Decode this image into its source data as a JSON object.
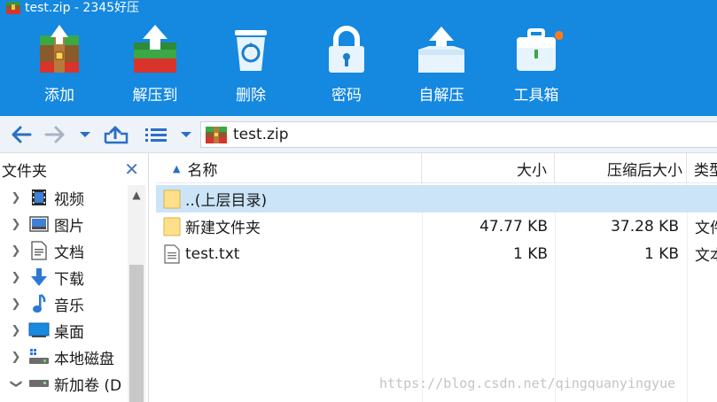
{
  "window": {
    "title": "test.zip - 2345好压"
  },
  "toolbar": {
    "tools": [
      {
        "label": "添加",
        "icon": "add-archive-icon"
      },
      {
        "label": "解压到",
        "icon": "extract-to-icon"
      },
      {
        "label": "删除",
        "icon": "recycle-bin-icon"
      },
      {
        "label": "密码",
        "icon": "lock-icon"
      },
      {
        "label": "自解压",
        "icon": "self-extract-icon"
      },
      {
        "label": "工具箱",
        "icon": "toolbox-icon"
      }
    ]
  },
  "nav": {
    "back_icon": "back-arrow-icon",
    "forward_icon": "forward-arrow-icon",
    "dropdown_icon": "chevron-down-icon",
    "up_icon": "up-folder-icon",
    "view_icon": "list-view-icon",
    "path": "test.zip"
  },
  "sidebar": {
    "title": "文件夹",
    "close_icon": "close-icon",
    "items": [
      {
        "label": "视频",
        "icon": "video-icon"
      },
      {
        "label": "图片",
        "icon": "picture-icon"
      },
      {
        "label": "文档",
        "icon": "document-icon"
      },
      {
        "label": "下载",
        "icon": "download-icon"
      },
      {
        "label": "音乐",
        "icon": "music-icon"
      },
      {
        "label": "桌面",
        "icon": "desktop-icon"
      },
      {
        "label": "本地磁盘",
        "icon": "local-disk-icon"
      },
      {
        "label": "新加卷 (D",
        "icon": "drive-icon"
      }
    ]
  },
  "filelist": {
    "columns": {
      "name": "名称",
      "size": "大小",
      "packed": "压缩后大小",
      "type": "类型"
    },
    "rows": [
      {
        "name": "..(上层目录)",
        "size": "",
        "packed": "",
        "type": "",
        "icon": "folder-icon",
        "selected": true
      },
      {
        "name": "新建文件夹",
        "size": "47.77 KB",
        "packed": "37.28 KB",
        "type": "文件",
        "icon": "folder-icon",
        "selected": false
      },
      {
        "name": "test.txt",
        "size": "1 KB",
        "packed": "1 KB",
        "type": "文本",
        "icon": "text-file-icon",
        "selected": false
      }
    ]
  },
  "watermark": "https://blog.csdn.net/qingquanyingyue",
  "colors": {
    "toolbar_bg": "#1588e0",
    "selected_row": "#cce4f7",
    "accent": "#2b6fc4"
  }
}
